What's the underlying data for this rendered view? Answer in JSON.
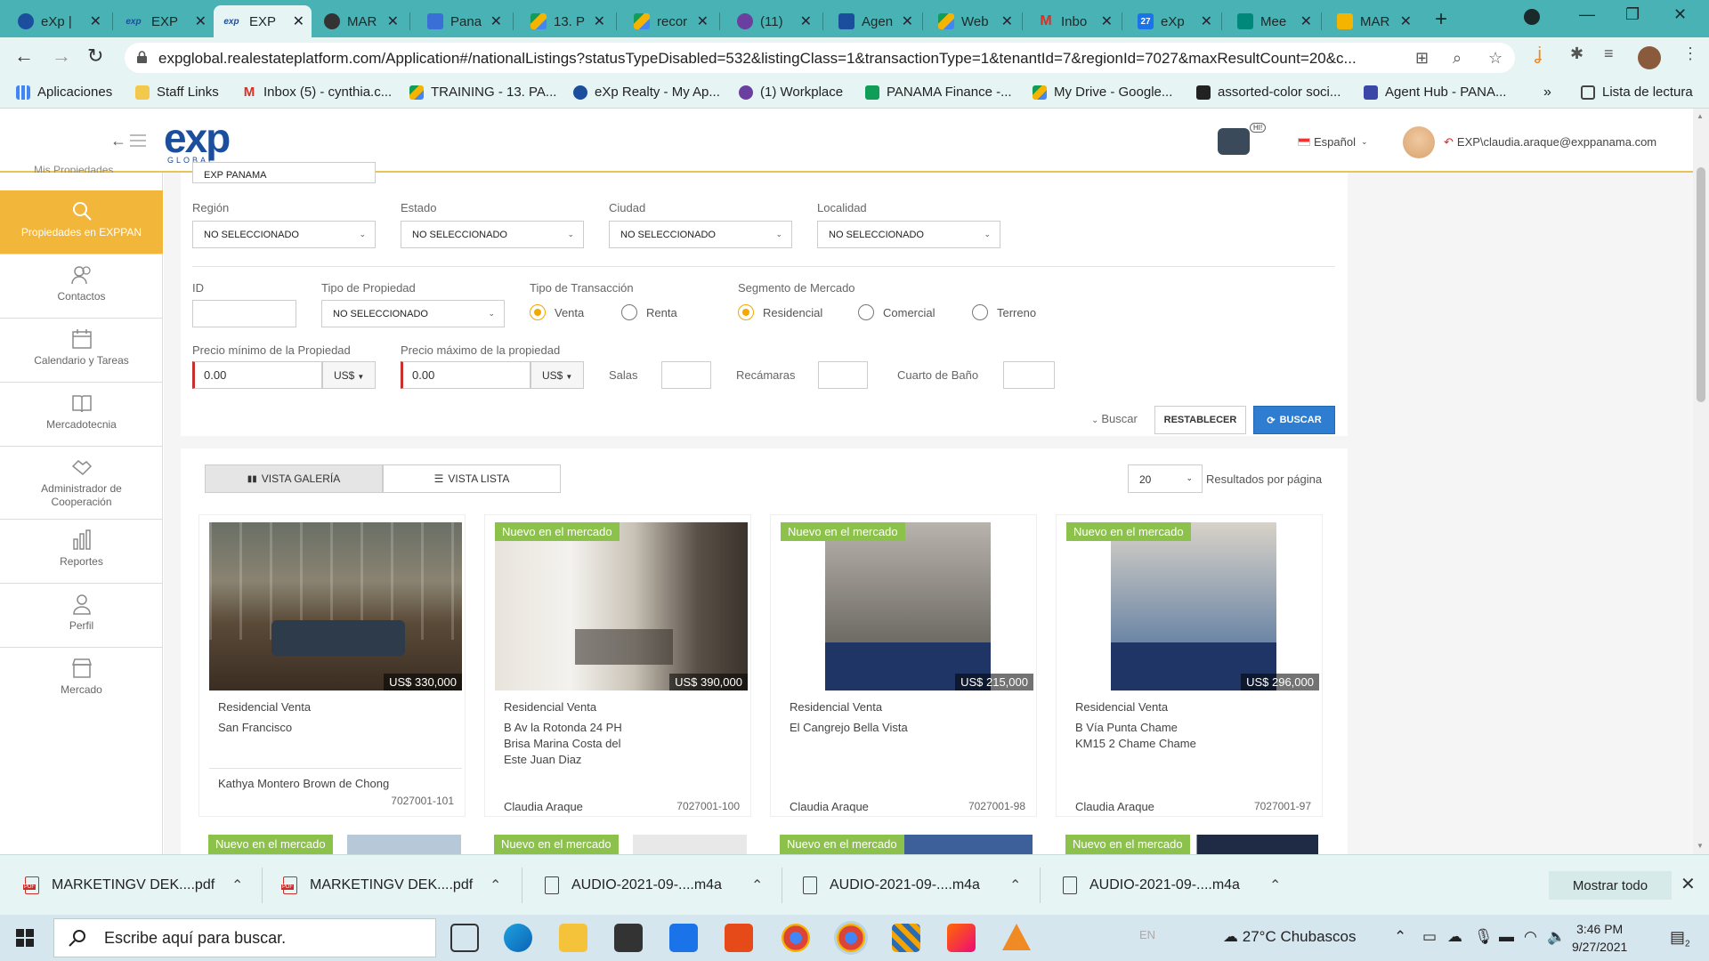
{
  "browser": {
    "tabs": [
      {
        "title": "eXp |",
        "color": "#1c4e9e"
      },
      {
        "title": "EXP",
        "color": "#1c4e9e"
      },
      {
        "title": "EXP",
        "color": "#1c4e9e"
      },
      {
        "title": "MAR",
        "color": "#333333"
      },
      {
        "title": "Pana",
        "color": "#3a6fd8"
      },
      {
        "title": "13. P",
        "color": "#f4b400"
      },
      {
        "title": "recor",
        "color": "#0f9d58"
      },
      {
        "title": "(11)",
        "color": "#6b3fa0"
      },
      {
        "title": "Agen",
        "color": "#1c4e9e"
      },
      {
        "title": "Web",
        "color": "#f4b400"
      },
      {
        "title": "Inbo",
        "color": "#d93025"
      },
      {
        "title": "eXp",
        "color": "#1a73e8"
      },
      {
        "title": "Mee",
        "color": "#00897b"
      },
      {
        "title": "MAR",
        "color": "#f4b400"
      }
    ],
    "url": "expglobal.realestateplatform.com/Application#/nationalListings?statusTypeDisabled=532&listingClass=1&transactionType=1&tenantId=7&regionId=7027&maxResultCount=20&c...",
    "bookmarks": [
      {
        "label": "Aplicaciones",
        "color": "#4285f4"
      },
      {
        "label": "Staff Links",
        "color": "#f2c94c"
      },
      {
        "label": "Inbox (5) - cynthia.c...",
        "color": "#d93025"
      },
      {
        "label": "TRAINING - 13. PA...",
        "color": "#f4b400"
      },
      {
        "label": "eXp Realty - My Ap...",
        "color": "#1c4e9e"
      },
      {
        "label": "(1) Workplace",
        "color": "#6b3fa0"
      },
      {
        "label": "PANAMA Finance -...",
        "color": "#0f9d58"
      },
      {
        "label": "My Drive - Google...",
        "color": "#f4b400"
      },
      {
        "label": "assorted-color soci...",
        "color": "#222222"
      },
      {
        "label": "Agent Hub - PANA...",
        "color": "#3a46a8"
      },
      {
        "label": "Lista de lectura",
        "color": "#444444"
      }
    ]
  },
  "header": {
    "logo_main": "exp",
    "logo_sub": "GLOBAL",
    "bot_badge": "HI!",
    "language": "Español",
    "user": "EXP\\claudia.araque@exppanama.com"
  },
  "sidebar": {
    "cut_label": "Mis Propiedades",
    "items": [
      {
        "label": "Propiedades en EXPPAN"
      },
      {
        "label": "Contactos"
      },
      {
        "label": "Calendario y Tareas"
      },
      {
        "label": "Mercadotecnia"
      },
      {
        "label": "Administrador de Cooperación"
      },
      {
        "label": "Reportes"
      },
      {
        "label": "Perfil"
      },
      {
        "label": "Mercado"
      }
    ]
  },
  "filters": {
    "tenant_value": "EXP PANAMA",
    "region": {
      "label": "Región",
      "value": "NO SELECCIONADO"
    },
    "estado": {
      "label": "Estado",
      "value": "NO SELECCIONADO"
    },
    "ciudad": {
      "label": "Ciudad",
      "value": "NO SELECCIONADO"
    },
    "localidad": {
      "label": "Localidad",
      "value": "NO SELECCIONADO"
    },
    "id_label": "ID",
    "tipo_propiedad": {
      "label": "Tipo de Propiedad",
      "value": "NO SELECCIONADO"
    },
    "tipo_transaccion": {
      "label": "Tipo de Transacción",
      "options": [
        "Venta",
        "Renta"
      ],
      "selected": "Venta"
    },
    "segmento": {
      "label": "Segmento de Mercado",
      "options": [
        "Residencial",
        "Comercial",
        "Terreno"
      ],
      "selected": "Residencial"
    },
    "precio_min": {
      "label": "Precio mínimo de la Propiedad",
      "value": "0.00",
      "currency": "US$"
    },
    "precio_max": {
      "label": "Precio máximo de la propiedad",
      "value": "0.00",
      "currency": "US$"
    },
    "salas_label": "Salas",
    "recamaras_label": "Recámaras",
    "banos_label": "Cuarto de Baño",
    "toggle_label": "Buscar",
    "reset_label": "RESTABLECER",
    "search_label": "BUSCAR"
  },
  "results": {
    "gallery_label": "VISTA GALERÍA",
    "list_label": "VISTA LISTA",
    "per_page": "20",
    "per_page_label": "Resultados por página",
    "listings": [
      {
        "badge": "",
        "price": "US$ 330,000",
        "type": "Residencial Venta",
        "address": "San Francisco",
        "agent": "Kathya Montero Brown de Chong",
        "id": "7027001-101"
      },
      {
        "badge": "Nuevo en el mercado",
        "price": "US$ 390,000",
        "type": "Residencial Venta",
        "address": "B Av la Rotonda 24 PH Brisa Marina Costa del Este Juan Diaz",
        "agent": "Claudia Araque",
        "id": "7027001-100"
      },
      {
        "badge": "Nuevo en el mercado",
        "price": "US$ 215,000",
        "type": "Residencial Venta",
        "address": "El Cangrejo Bella Vista",
        "agent": "Claudia Araque",
        "id": "7027001-98"
      },
      {
        "badge": "Nuevo en el mercado",
        "price": "US$ 296,000",
        "type": "Residencial Venta",
        "address": "B Vía Punta Chame KM15 2 Chame Chame",
        "agent": "Claudia Araque",
        "id": "7027001-97"
      }
    ],
    "next_row_badges": [
      "Nuevo en el mercado",
      "Nuevo en el mercado",
      "Nuevo en el mercado",
      "Nuevo en el mercado"
    ]
  },
  "downloads": {
    "items": [
      {
        "name": "MARKETINGV DEK....pdf",
        "kind": "pdf"
      },
      {
        "name": "MARKETINGV DEK....pdf",
        "kind": "pdf"
      },
      {
        "name": "AUDIO-2021-09-....m4a",
        "kind": "audio"
      },
      {
        "name": "AUDIO-2021-09-....m4a",
        "kind": "audio"
      },
      {
        "name": "AUDIO-2021-09-....m4a",
        "kind": "audio"
      }
    ],
    "show_all": "Mostrar todo"
  },
  "taskbar": {
    "search_placeholder": "Escribe aquí para buscar.",
    "weather": "27°C Chubascos",
    "lang": "EN",
    "time": "3:46 PM",
    "date": "9/27/2021",
    "notifications": "2"
  },
  "colors": {
    "accent": "#f2b63a",
    "primary": "#2f7dd1",
    "badge": "#8cc14c",
    "chrome": "#48b2b4"
  }
}
